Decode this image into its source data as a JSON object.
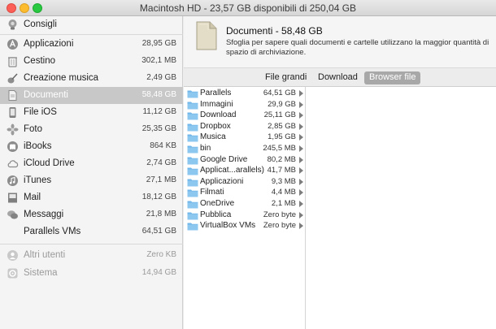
{
  "window": {
    "title": "Macintosh HD - 23,57 GB disponibili di 250,04 GB"
  },
  "sidebar": {
    "items": [
      {
        "label": "Consigli",
        "value": "",
        "icon": "bulb-icon"
      },
      {
        "label": "Applicazioni",
        "value": "28,95 GB",
        "icon": "applications-icon"
      },
      {
        "label": "Cestino",
        "value": "302,1 MB",
        "icon": "trash-icon"
      },
      {
        "label": "Creazione musica",
        "value": "2,49 GB",
        "icon": "guitar-icon"
      },
      {
        "label": "Documenti",
        "value": "58,48 GB",
        "icon": "document-icon"
      },
      {
        "label": "File iOS",
        "value": "11,12 GB",
        "icon": "ios-device-icon"
      },
      {
        "label": "Foto",
        "value": "25,35 GB",
        "icon": "photos-icon"
      },
      {
        "label": "iBooks",
        "value": "864 KB",
        "icon": "books-icon"
      },
      {
        "label": "iCloud Drive",
        "value": "2,74 GB",
        "icon": "cloud-icon"
      },
      {
        "label": "iTunes",
        "value": "27,1 MB",
        "icon": "music-note-icon"
      },
      {
        "label": "Mail",
        "value": "18,12 GB",
        "icon": "mail-icon"
      },
      {
        "label": "Messaggi",
        "value": "21,8 MB",
        "icon": "messages-icon"
      },
      {
        "label": "Parallels VMs",
        "value": "64,51 GB",
        "icon": ""
      }
    ],
    "footer_items": [
      {
        "label": "Altri utenti",
        "value": "Zero KB",
        "icon": "users-icon"
      },
      {
        "label": "Sistema",
        "value": "14,94 GB",
        "icon": "gear-icon"
      }
    ]
  },
  "header": {
    "title": "Documenti - 58,48 GB",
    "description": "Sfoglia per sapere quali documenti e cartelle utilizzano la maggior quantità di spazio di archiviazione."
  },
  "tabs": [
    {
      "label": "File grandi"
    },
    {
      "label": "Download"
    },
    {
      "label": "Browser file"
    }
  ],
  "files": [
    {
      "name": "Parallels",
      "size": "64,51 GB"
    },
    {
      "name": "Immagini",
      "size": "29,9 GB"
    },
    {
      "name": "Download",
      "size": "25,11 GB"
    },
    {
      "name": "Dropbox",
      "size": "2,85 GB"
    },
    {
      "name": "Musica",
      "size": "1,95 GB"
    },
    {
      "name": "bin",
      "size": "245,5 MB"
    },
    {
      "name": "Google Drive",
      "size": "80,2 MB"
    },
    {
      "name": "Applicat...arallels)",
      "size": "41,7 MB"
    },
    {
      "name": "Applicazioni",
      "size": "9,3 MB"
    },
    {
      "name": "Filmati",
      "size": "4,4 MB"
    },
    {
      "name": "OneDrive",
      "size": "2,1 MB"
    },
    {
      "name": "Pubblica",
      "size": "Zero byte"
    },
    {
      "name": "VirtualBox VMs",
      "size": "Zero byte"
    }
  ],
  "colors": {
    "selected_row": "#c8c8c8",
    "active_tab": "#a8a8a8",
    "folder": "#6fb6ea"
  }
}
